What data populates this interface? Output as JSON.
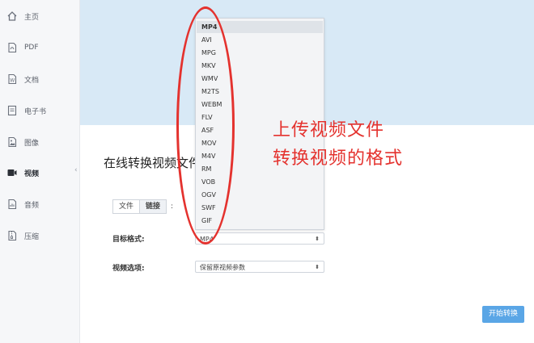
{
  "sidebar": {
    "items": [
      {
        "label": "主页",
        "icon": "home-icon"
      },
      {
        "label": "PDF",
        "icon": "pdf-file-icon"
      },
      {
        "label": "文档",
        "icon": "word-document-icon"
      },
      {
        "label": "电子书",
        "icon": "ebook-icon"
      },
      {
        "label": "图像",
        "icon": "image-icon"
      },
      {
        "label": "视频",
        "icon": "video-icon",
        "active": true
      },
      {
        "label": "音频",
        "icon": "audio-icon"
      },
      {
        "label": "压缩",
        "icon": "archive-icon"
      }
    ]
  },
  "main": {
    "title": "在线转换视频文件",
    "source_tabs": [
      "文件",
      "链接"
    ],
    "source_tabs_suffix": ":",
    "target_format_label": "目标格式:",
    "target_format_value": "MP4",
    "video_options_label": "视频选项:",
    "video_options_value": "保留原视频参数",
    "start_button": "开始转换"
  },
  "dropdown": {
    "options": [
      "MP4",
      "AVI",
      "MPG",
      "MKV",
      "WMV",
      "M2TS",
      "WEBM",
      "FLV",
      "ASF",
      "MOV",
      "M4V",
      "RM",
      "VOB",
      "OGV",
      "SWF",
      "GIF"
    ],
    "selected": "MP4"
  },
  "annotation": {
    "line1": "上传视频文件",
    "line2": "转换视频的格式",
    "color": "#e4322e"
  },
  "colors": {
    "hero": "#d8e9f6",
    "accent": "#5aa6e6",
    "sidebar": "#f6f7f9"
  }
}
